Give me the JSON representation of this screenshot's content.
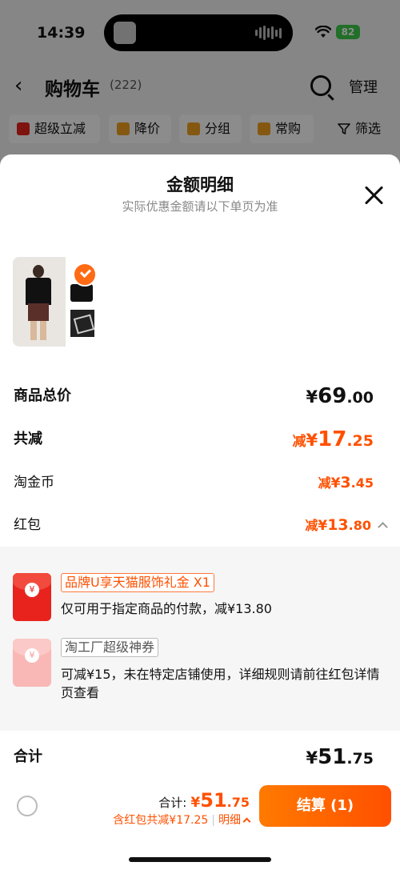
{
  "status_bar": {
    "time": "14:39",
    "battery": "82"
  },
  "nav": {
    "back": "‹",
    "title": "购物车",
    "count": "(222)",
    "manage": "管理"
  },
  "filters": [
    {
      "label": "超级立减",
      "color": "#e8231e"
    },
    {
      "label": "降价",
      "color": "#f0a020"
    },
    {
      "label": "分组",
      "color": "#f0a020"
    },
    {
      "label": "常购",
      "color": "#f0a020"
    }
  ],
  "filter_right": "筛选",
  "sheet": {
    "title": "金额明细",
    "subtitle": "实际优惠金额请以下单页为准",
    "rows": {
      "total": {
        "label": "商品总价",
        "yen": "¥",
        "int": "69",
        "dec": ".00"
      },
      "discount": {
        "label": "共减",
        "prefix": "减",
        "yen": "¥",
        "int": "17",
        "dec": ".25"
      },
      "coin": {
        "label": "淘金币",
        "prefix": "减",
        "yen": "¥",
        "int": "3",
        "dec": ".45"
      },
      "redpacket": {
        "label": "红包",
        "prefix": "减",
        "yen": "¥",
        "int": "13",
        "dec": ".80"
      }
    },
    "red_packets": [
      {
        "tag": "品牌U享天猫服饰礼金 X1",
        "desc": "仅可用于指定商品的付款，减¥13.80",
        "coin": "¥"
      },
      {
        "tag": "淘工厂超级神券",
        "desc": "可减¥15，未在特定店铺使用，详细规则请前往红包详情页查看",
        "coin": "¥"
      }
    ],
    "sum": {
      "label": "合计",
      "yen": "¥",
      "int": "51",
      "dec": ".75"
    }
  },
  "footer": {
    "total_label": "合计:",
    "yen": "¥",
    "int": "51",
    "dec": ".75",
    "discount_note": "含红包共减¥17.25",
    "detail": "明细",
    "checkout": "结算 (1)"
  }
}
